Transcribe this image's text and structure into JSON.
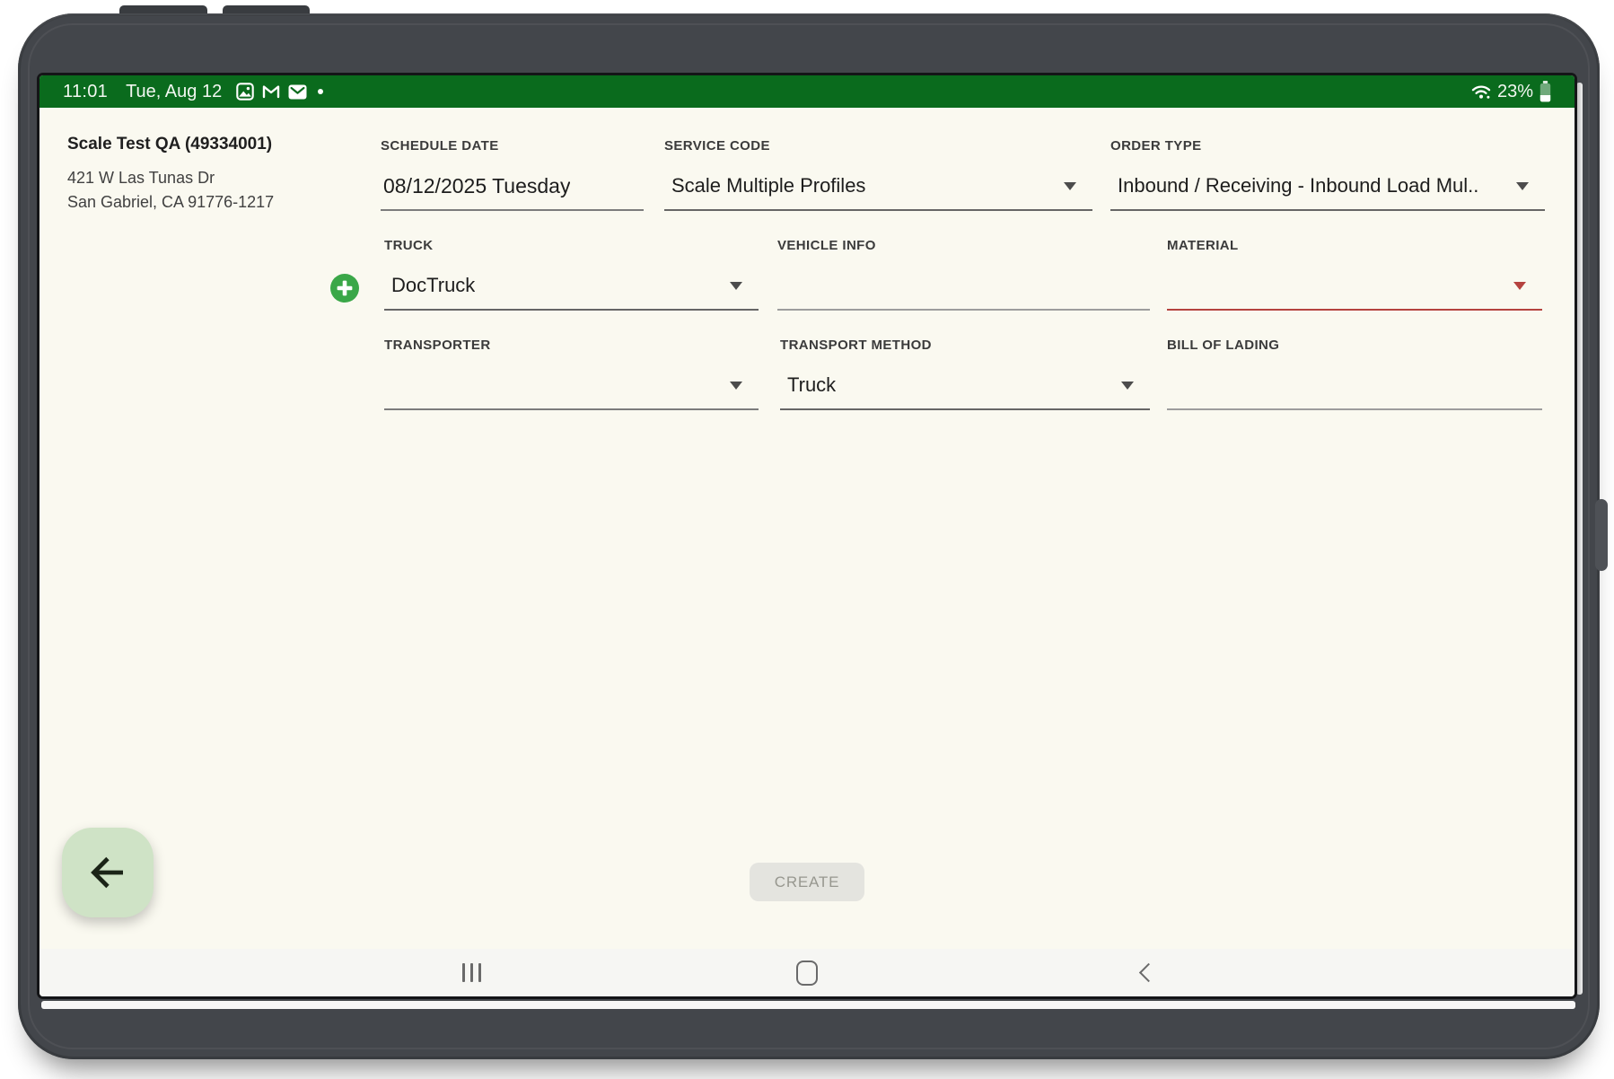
{
  "device": {
    "status_bar": {
      "time": "11:01",
      "date": "Tue, Aug 12",
      "battery_percent": "23%",
      "left_icons": [
        "photos-icon",
        "gmail-icon",
        "email-icon",
        "notification-dot"
      ],
      "right_icons": [
        "wifi-icon",
        "battery-icon"
      ],
      "bg_color": "#0a6b1d"
    },
    "nav_bar": {
      "icons": [
        "recents-icon",
        "home-icon",
        "back-icon"
      ]
    }
  },
  "header": {
    "account_name": "Scale Test QA (49334001)",
    "address_line1": "421 W Las Tunas Dr",
    "address_line2": "San Gabriel, CA 91776-1217"
  },
  "form": {
    "schedule_date": {
      "label": "SCHEDULE DATE",
      "value": "08/12/2025 Tuesday"
    },
    "service_code": {
      "label": "SERVICE CODE",
      "value": "Scale Multiple Profiles"
    },
    "order_type": {
      "label": "ORDER TYPE",
      "value": "Inbound / Receiving - Inbound Load Mul.."
    },
    "truck": {
      "label": "TRUCK",
      "value": "DocTruck"
    },
    "vehicle_info": {
      "label": "VEHICLE INFO",
      "value": ""
    },
    "material": {
      "label": "MATERIAL",
      "value": ""
    },
    "transporter": {
      "label": "TRANSPORTER",
      "value": ""
    },
    "transport_method": {
      "label": "TRANSPORT METHOD",
      "value": "Truck"
    },
    "bill_of_lading": {
      "label": "BILL OF LADING",
      "value": ""
    }
  },
  "actions": {
    "create_label": "CREATE",
    "back_icon": "back-arrow-icon",
    "add_icon": "add-circle-icon"
  },
  "colors": {
    "status_bar_green": "#0a6b1d",
    "app_background": "#faf9f0",
    "error_red": "#b5433f",
    "add_button_green": "#3aa748",
    "back_button_bg": "#cfe3c6",
    "disabled_button_bg": "#e4e4df"
  }
}
